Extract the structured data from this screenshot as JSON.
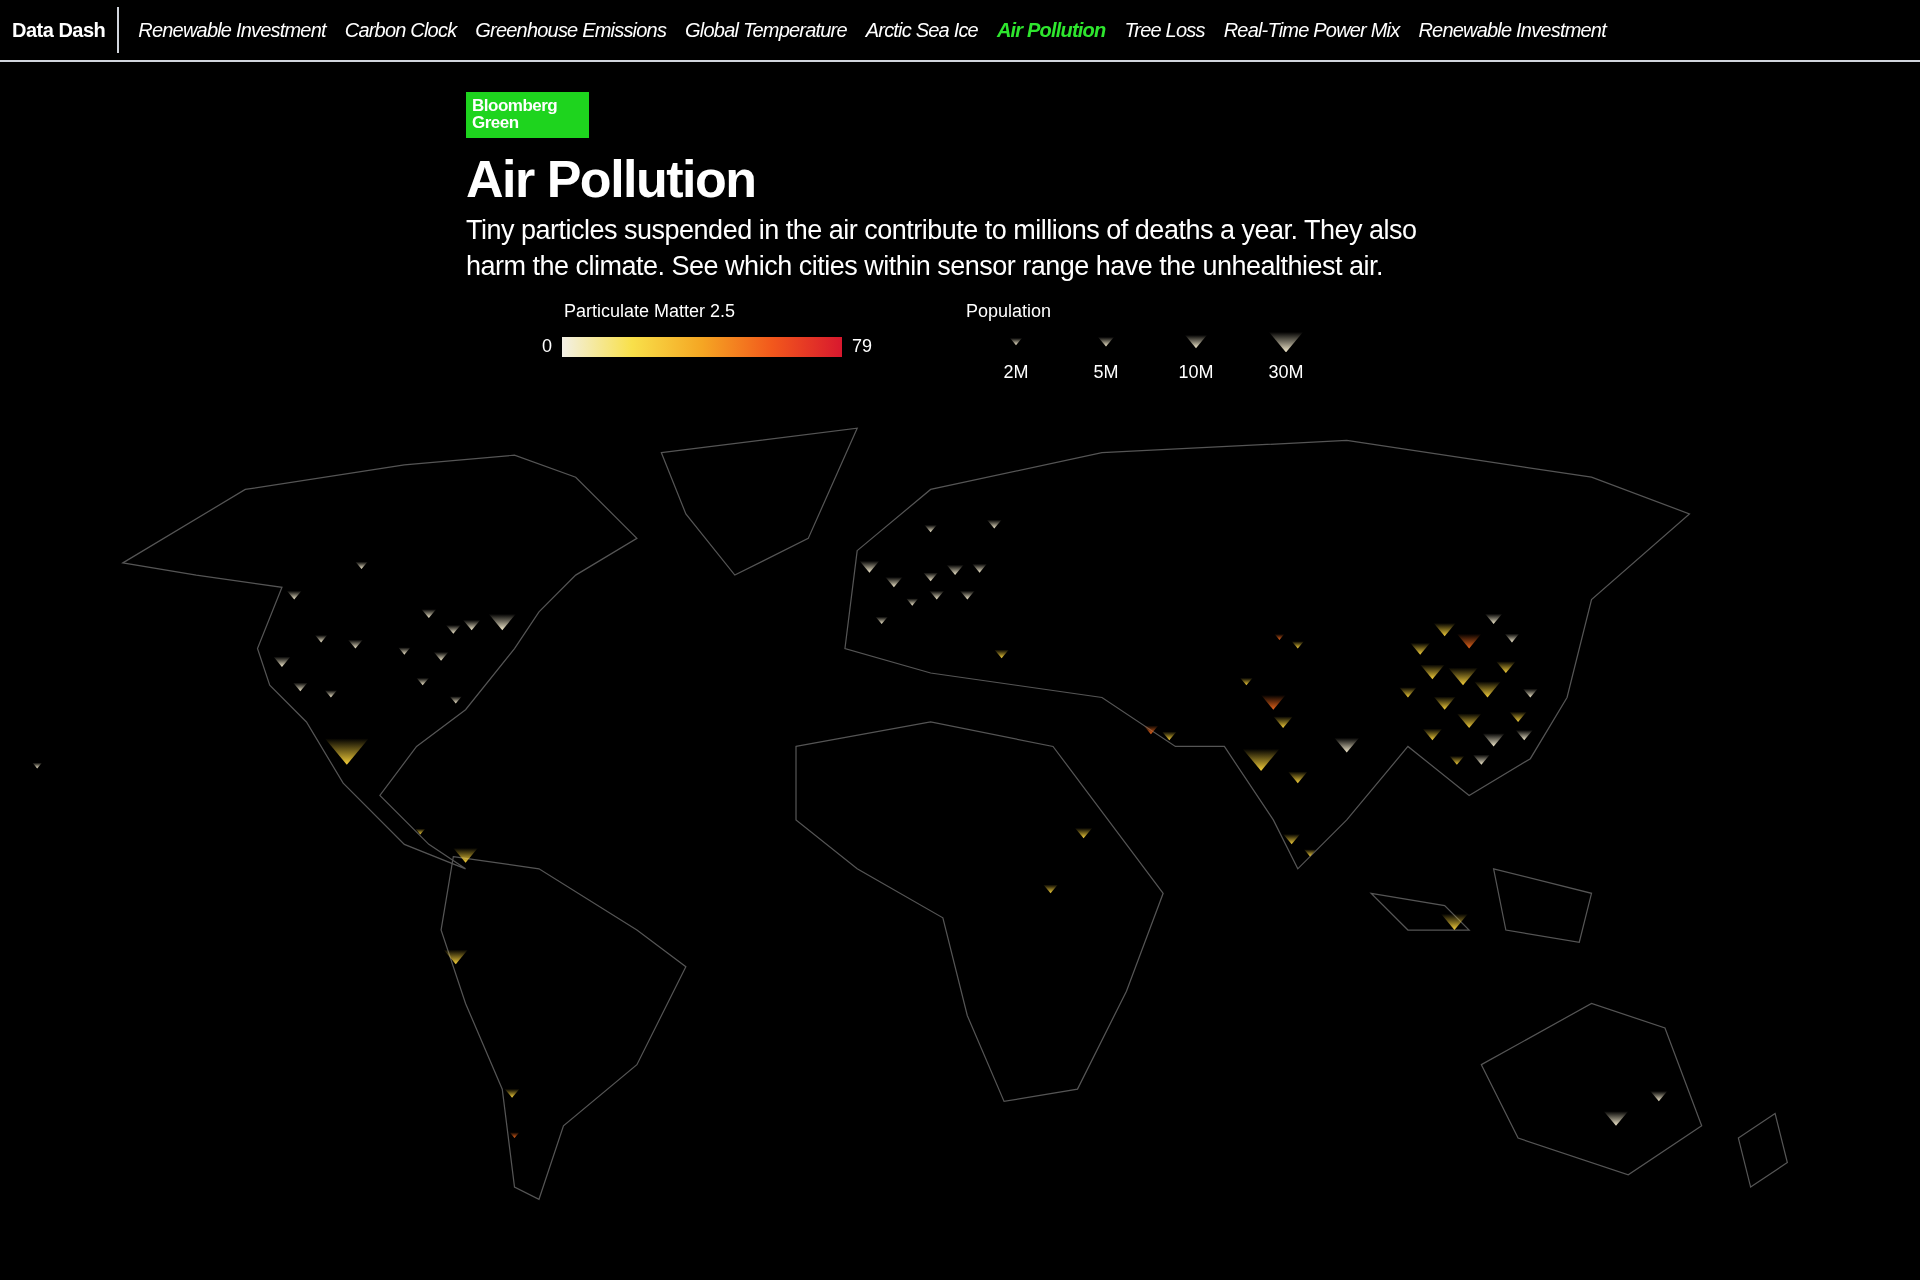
{
  "nav": {
    "brand": "Data Dash",
    "items": [
      {
        "label": "Renewable Investment",
        "selected": false
      },
      {
        "label": "Carbon Clock",
        "selected": false
      },
      {
        "label": "Greenhouse Emissions",
        "selected": false
      },
      {
        "label": "Global Temperature",
        "selected": false
      },
      {
        "label": "Arctic Sea Ice",
        "selected": false
      },
      {
        "label": "Air Pollution",
        "selected": true
      },
      {
        "label": "Tree Loss",
        "selected": false
      },
      {
        "label": "Real-Time Power Mix",
        "selected": false
      },
      {
        "label": "Renewable Investment",
        "selected": false
      }
    ]
  },
  "logo": {
    "lines": [
      "Bloomberg",
      "Green"
    ]
  },
  "title": "Air Pollution",
  "description": "Tiny particles suspended in the air contribute to millions of deaths a year. They also harm the climate. See which cities within sensor range have the unhealthiest air.",
  "legend": {
    "pm_label": "Particulate Matter 2.5",
    "min": "0",
    "max": "79",
    "population_label": "Population",
    "population_sizes": [
      "2M",
      "5M",
      "10M",
      "30M"
    ]
  }
}
